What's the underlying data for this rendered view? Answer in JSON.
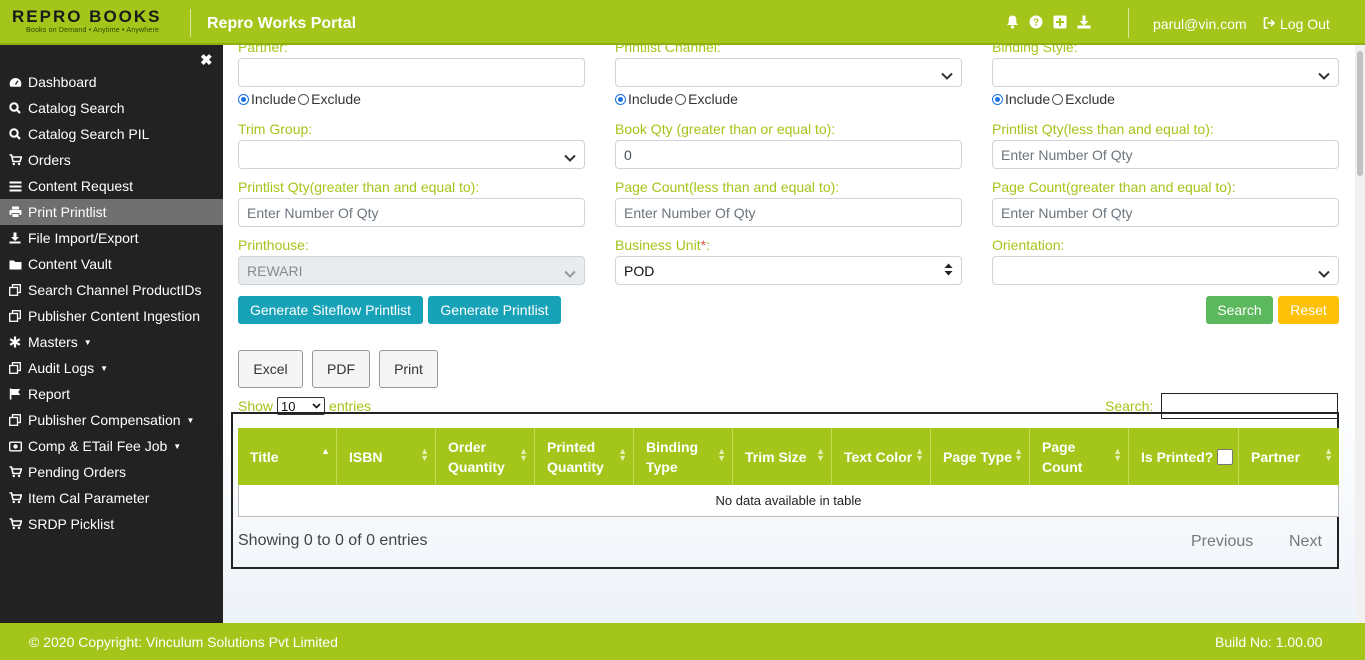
{
  "header": {
    "logo_text": "REPRO BOOKS",
    "logo_tagline": "Books on Demand • Anytime • Anywhere",
    "app_title": "Repro Works Portal",
    "icons": [
      "bell-icon",
      "help-icon",
      "plus-square-icon",
      "download-icon"
    ],
    "user_email": "parul@vin.com",
    "logout_label": "Log Out"
  },
  "sidebar": {
    "items": [
      {
        "label": "Dashboard",
        "icon": "dashboard-icon"
      },
      {
        "label": "Catalog Search",
        "icon": "search-icon"
      },
      {
        "label": "Catalog Search PIL",
        "icon": "search-icon"
      },
      {
        "label": "Orders",
        "icon": "cart-icon"
      },
      {
        "label": "Content Request",
        "icon": "list-icon"
      },
      {
        "label": "Print Printlist",
        "icon": "print-icon"
      },
      {
        "label": "File Import/Export",
        "icon": "download-icon"
      },
      {
        "label": "Content Vault",
        "icon": "folder-icon"
      },
      {
        "label": "Search Channel ProductIDs",
        "icon": "clone-icon"
      },
      {
        "label": "Publisher Content Ingestion",
        "icon": "clone-icon"
      },
      {
        "label": "Masters",
        "icon": "asterisk-icon"
      },
      {
        "label": "Audit Logs",
        "icon": "clone-icon"
      },
      {
        "label": "Report",
        "icon": "flag-icon"
      },
      {
        "label": "Publisher Compensation",
        "icon": "clone-icon"
      },
      {
        "label": "Comp & ETail Fee Job",
        "icon": "money-icon"
      },
      {
        "label": "Pending Orders",
        "icon": "cart-icon"
      },
      {
        "label": "Item Cal Parameter",
        "icon": "cart-icon"
      },
      {
        "label": "SRDP Picklist",
        "icon": "cart-icon"
      }
    ]
  },
  "filters": {
    "partner_label": "Partner:",
    "printlist_channel_label": "Printlist Channel:",
    "binding_style_label": "Binding Style:",
    "include_label": "Include",
    "exclude_label": "Exclude",
    "trim_group_label": "Trim Group:",
    "book_qty_label": "Book Qty (greater than or equal to):",
    "book_qty_value": "0",
    "printlist_qty_le_label": "Printlist Qty(less than and equal to):",
    "printlist_qty_ge_label": "Printlist Qty(greater than and equal to):",
    "page_count_le_label": "Page Count(less than and equal to):",
    "page_count_ge_label": "Page Count(greater than and equal to):",
    "qty_placeholder": "Enter Number Of Qty",
    "printhouse_label": "Printhouse:",
    "printhouse_value": "REWARI",
    "business_unit_label": "Business Unit",
    "required_mark": "*",
    "label_colon": ":",
    "business_unit_value": "POD",
    "orientation_label": "Orientation:"
  },
  "actions": {
    "generate_siteflow": "Generate Siteflow Printlist",
    "generate_printlist": "Generate Printlist",
    "search": "Search",
    "reset": "Reset",
    "excel": "Excel",
    "pdf": "PDF",
    "print": "Print"
  },
  "table": {
    "show_label": "Show",
    "entries_value": "10",
    "entries_label": "entries",
    "search_label": "Search:",
    "columns": [
      "Title",
      "ISBN",
      "Order Quantity",
      "Printed Quantity",
      "Binding Type",
      "Trim Size",
      "Text Color",
      "Page Type",
      "Page Count",
      "Is Printed?",
      "Partner"
    ],
    "empty_message": "No data available in table",
    "info": "Showing 0 to 0 of 0 entries",
    "previous": "Previous",
    "next": "Next"
  },
  "footer": {
    "copyright": "© 2020 Copyright: Vinculum Solutions Pvt Limited",
    "build": "Build No: 1.00.00"
  },
  "colors": {
    "brand": "#a4c519",
    "sidebar_bg": "#222222",
    "teal": "#17a2b8",
    "green": "#5cb85c",
    "orange": "#ffc107"
  }
}
